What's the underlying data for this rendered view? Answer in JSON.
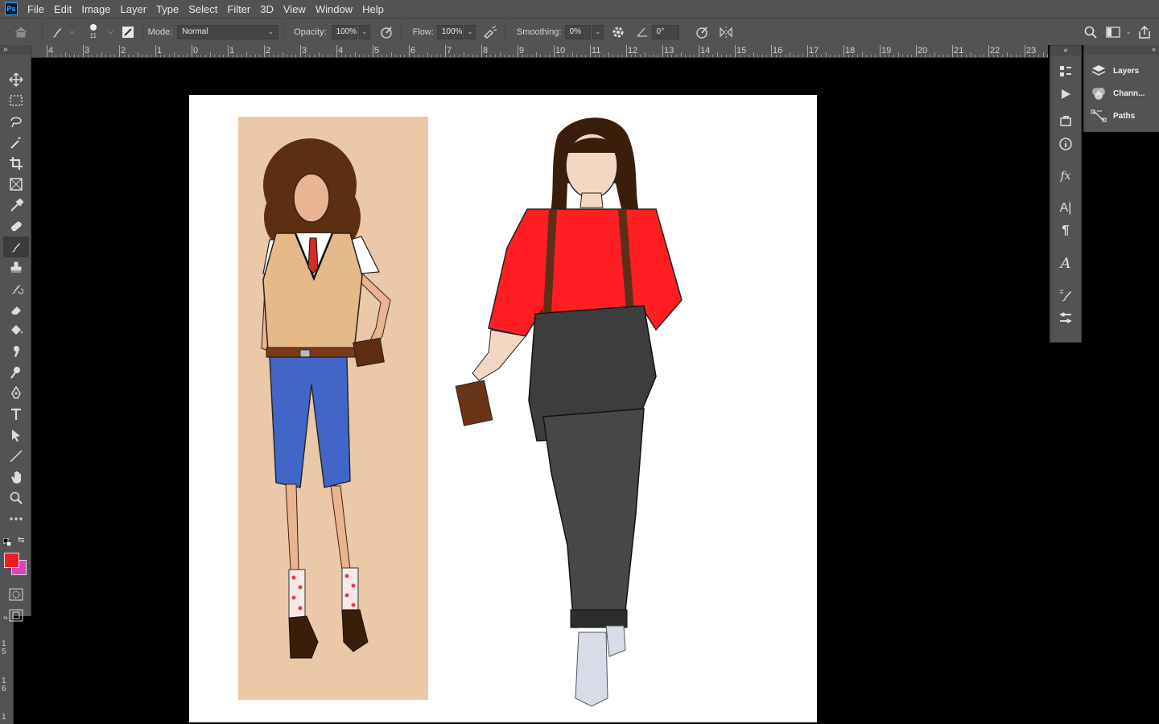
{
  "app": {
    "logo": "Ps"
  },
  "menu": [
    "File",
    "Edit",
    "Image",
    "Layer",
    "Type",
    "Select",
    "Filter",
    "3D",
    "View",
    "Window",
    "Help"
  ],
  "options": {
    "brush_size": "11",
    "mode_label": "Mode:",
    "mode_value": "Normal",
    "opacity_label": "Opacity:",
    "opacity_value": "100%",
    "flow_label": "Flow:",
    "flow_value": "100%",
    "smoothing_label": "Smoothing:",
    "smoothing_value": "0%",
    "angle_value": "0°"
  },
  "ruler": {
    "top_labels": [
      "4",
      "3",
      "2",
      "1",
      "0",
      "1",
      "2",
      "3",
      "4",
      "5",
      "6",
      "7",
      "8",
      "9",
      "10",
      "11",
      "12",
      "13",
      "14",
      "15",
      "16",
      "17",
      "18",
      "19",
      "20",
      "21",
      "22",
      "23"
    ],
    "left_labels": [
      "4",
      "1 5",
      "1 6",
      "1"
    ]
  },
  "panels": {
    "items": [
      {
        "label": "Layers",
        "icon": "layers-icon"
      },
      {
        "label": "Chann...",
        "icon": "channels-icon"
      },
      {
        "label": "Paths",
        "icon": "paths-icon"
      }
    ]
  },
  "colors": {
    "foreground": "#ee1c25",
    "background": "#e040c0",
    "ui_bg": "#535353",
    "workspace": "#000000"
  },
  "tools": [
    "move-tool",
    "marquee-tool",
    "lasso-tool",
    "magic-wand-tool",
    "crop-tool",
    "frame-tool",
    "eyedropper-tool",
    "healing-tool",
    "brush-tool",
    "stamp-tool",
    "history-brush-tool",
    "eraser-tool",
    "paint-bucket-tool",
    "smudge-tool",
    "dodge-tool",
    "pen-tool",
    "type-tool",
    "path-select-tool",
    "line-tool",
    "hand-tool",
    "zoom-tool",
    "more-tools"
  ]
}
